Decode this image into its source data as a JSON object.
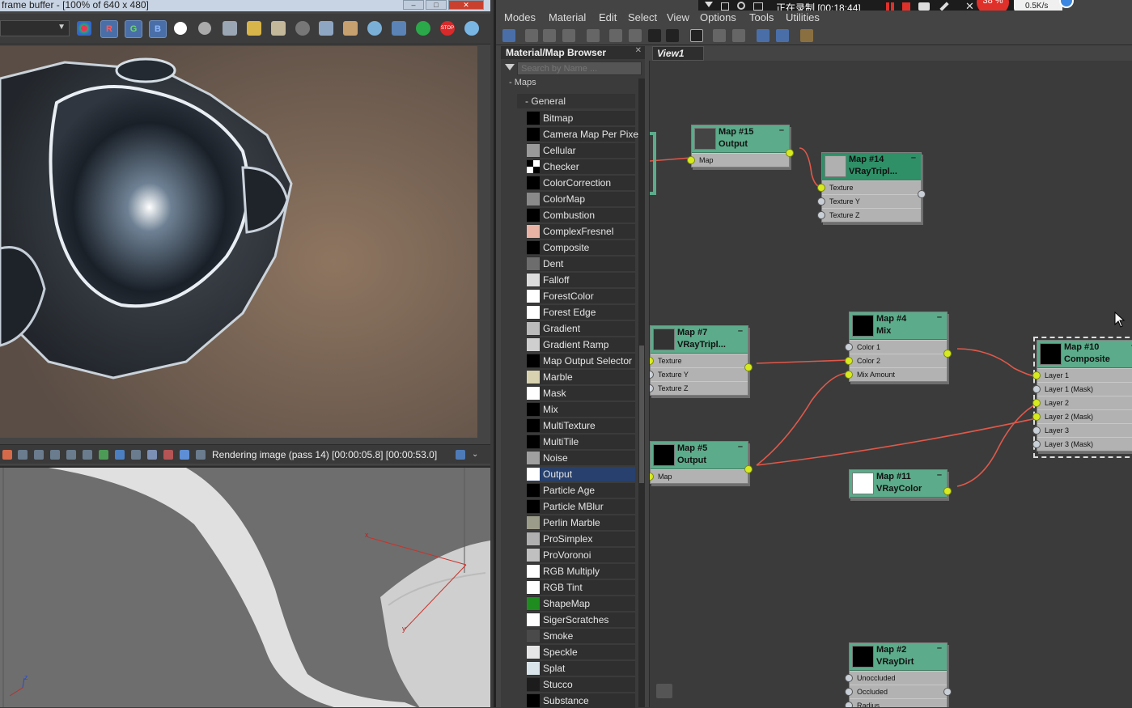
{
  "frame_buffer": {
    "title": "frame buffer - [100% of 640 x 480]",
    "window_buttons": [
      "–",
      "□",
      "✕"
    ],
    "rgb_toggles": [
      "R",
      "G",
      "B"
    ],
    "status": "Rendering image (pass 14) [00:00:05.8] [00:00:53.0]"
  },
  "viewport": {
    "gizmo_x": "x",
    "gizmo_y": "y",
    "gizmo_z": "z"
  },
  "recorder": {
    "text": "正在录制 [00:18:44]",
    "percent": "38 %",
    "speed": "0.5K/s"
  },
  "slate": {
    "menus": [
      "Modes",
      "Material",
      "Edit",
      "Select",
      "View",
      "Options",
      "Tools",
      "Utilities"
    ],
    "browser": {
      "title": "Material/Map Browser",
      "search_placeholder": "Search by Name ...",
      "tree_root": "- Maps",
      "group": "General",
      "maps": [
        {
          "name": "Bitmap",
          "swatch": "#000000"
        },
        {
          "name": "Camera Map Per Pixel",
          "swatch": "#000000"
        },
        {
          "name": "Cellular",
          "swatch": "#9a9a9a"
        },
        {
          "name": "Checker",
          "swatch": "checker"
        },
        {
          "name": "ColorCorrection",
          "swatch": "#000000"
        },
        {
          "name": "ColorMap",
          "swatch": "#8a8a8a"
        },
        {
          "name": "Combustion",
          "swatch": "#000000"
        },
        {
          "name": "ComplexFresnel",
          "swatch": "#e8b3a4"
        },
        {
          "name": "Composite",
          "swatch": "#000000"
        },
        {
          "name": "Dent",
          "swatch": "#6d6d6d"
        },
        {
          "name": "Falloff",
          "swatch": "#dcdcdc"
        },
        {
          "name": "ForestColor",
          "swatch": "#ffffff"
        },
        {
          "name": "Forest Edge",
          "swatch": "#ffffff"
        },
        {
          "name": "Gradient",
          "swatch": "#bbbbbb"
        },
        {
          "name": "Gradient Ramp",
          "swatch": "#cfcfcf"
        },
        {
          "name": "Map Output Selector",
          "swatch": "#000000"
        },
        {
          "name": "Marble",
          "swatch": "#d8d2b0"
        },
        {
          "name": "Mask",
          "swatch": "#ffffff"
        },
        {
          "name": "Mix",
          "swatch": "#000000"
        },
        {
          "name": "MultiTexture",
          "swatch": "#000000"
        },
        {
          "name": "MultiTile",
          "swatch": "#000000"
        },
        {
          "name": "Noise",
          "swatch": "#a0a0a0"
        },
        {
          "name": "Output",
          "swatch": "#ffffff",
          "selected": true
        },
        {
          "name": "Particle Age",
          "swatch": "#000000"
        },
        {
          "name": "Particle MBlur",
          "swatch": "#000000"
        },
        {
          "name": "Perlin Marble",
          "swatch": "#9c9c8a"
        },
        {
          "name": "ProSimplex",
          "swatch": "#b0b0b0"
        },
        {
          "name": "ProVoronoi",
          "swatch": "#c0c0c0"
        },
        {
          "name": "RGB Multiply",
          "swatch": "#ffffff"
        },
        {
          "name": "RGB Tint",
          "swatch": "#ffffff"
        },
        {
          "name": "ShapeMap",
          "swatch": "#1f8c1f"
        },
        {
          "name": "SigerScratches",
          "swatch": "#ffffff"
        },
        {
          "name": "Smoke",
          "swatch": "#4a4a4a"
        },
        {
          "name": "Speckle",
          "swatch": "#e6e6e6"
        },
        {
          "name": "Splat",
          "swatch": "#d9e4ea"
        },
        {
          "name": "Stucco",
          "swatch": "#1c1c1c"
        },
        {
          "name": "Substance",
          "swatch": "#000000"
        }
      ]
    },
    "view_tab": "View1",
    "nodes": {
      "n15": {
        "t1": "Map #15",
        "t2": "Output",
        "slots": [
          "Map"
        ]
      },
      "n14": {
        "t1": "Map #14",
        "t2": "VRayTripl...",
        "slots": [
          "Texture",
          "Texture Y",
          "Texture Z"
        ]
      },
      "n7": {
        "t1": "Map #7",
        "t2": "VRayTripl...",
        "slots": [
          "Texture",
          "Texture Y",
          "Texture Z"
        ]
      },
      "n4": {
        "t1": "Map #4",
        "t2": "Mix",
        "slots": [
          "Color 1",
          "Color 2",
          "Mix Amount"
        ]
      },
      "n10": {
        "t1": "Map #10",
        "t2": "Composite",
        "slots": [
          "Layer 1",
          "Layer 1 (Mask)",
          "Layer 2",
          "Layer 2 (Mask)",
          "Layer 3",
          "Layer 3 (Mask)"
        ]
      },
      "n5": {
        "t1": "Map #5",
        "t2": "Output",
        "slots": [
          "Map"
        ]
      },
      "n11": {
        "t1": "Map #11",
        "t2": "VRayColor",
        "slots": []
      },
      "n2": {
        "t1": "Map #2",
        "t2": "VRayDirt",
        "slots": [
          "Unoccluded",
          "Occluded",
          "Radius"
        ]
      }
    },
    "min_glyph": "–"
  },
  "colors": {
    "node_header": "#5cab8a",
    "node_header_selected": "#2f9068",
    "wire": "#e0584a",
    "socket_active": "#d7ea1f",
    "selection": "#27406d",
    "record_red": "#e0302a"
  }
}
